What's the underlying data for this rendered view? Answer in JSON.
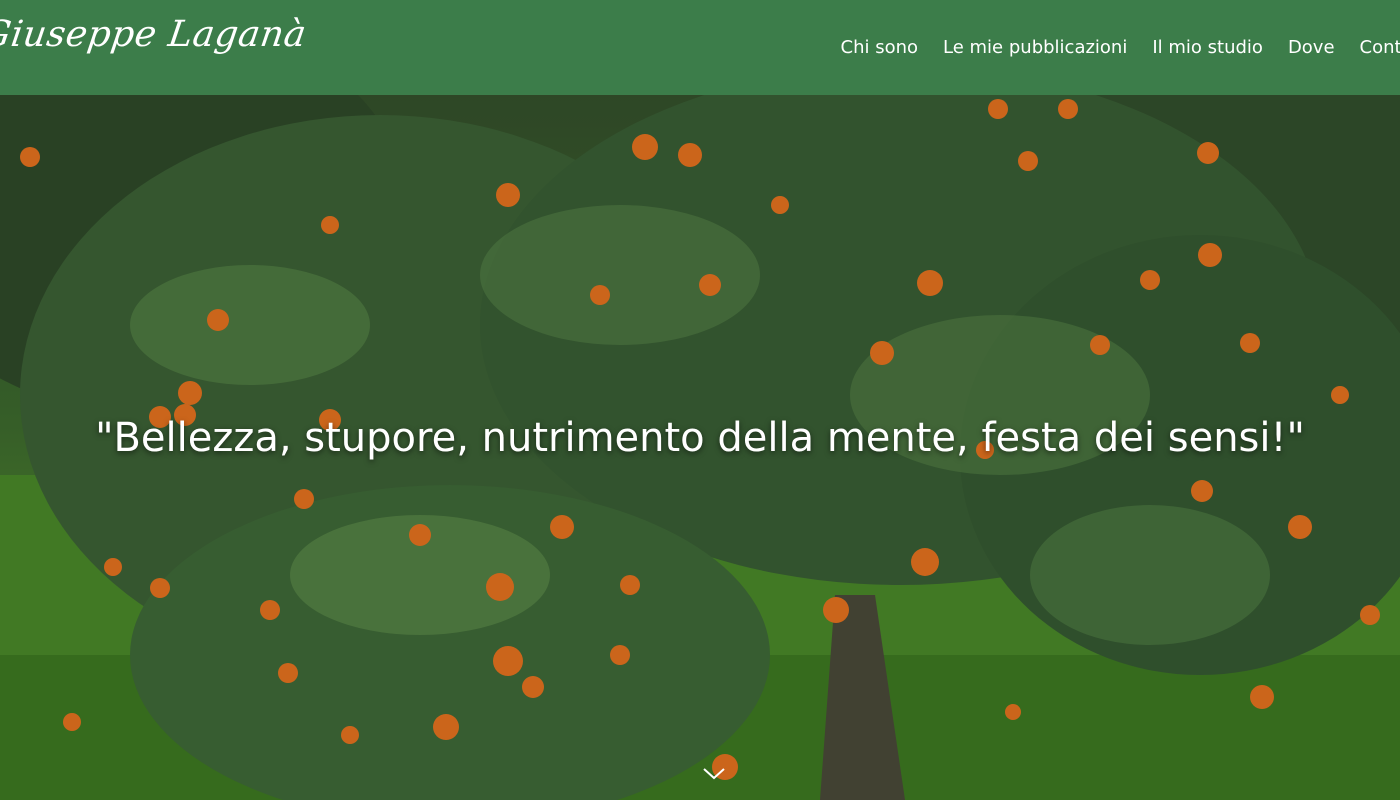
{
  "header": {
    "logo_text": "Giuseppe Laganà",
    "nav": [
      {
        "label": "Chi sono"
      },
      {
        "label": "Le mie pubblicazioni"
      },
      {
        "label": "Il mio studio"
      },
      {
        "label": "Dove"
      },
      {
        "label": "Contatti"
      }
    ]
  },
  "hero": {
    "quote": "\"Bellezza, stupore, nutrimento della mente, festa dei sensi!\"",
    "background_image": "orange-grove-photo",
    "scroll_icon": "chevron-down-icon"
  },
  "colors": {
    "header_bg": "#3c7d4a",
    "text": "#ffffff",
    "orange_fruit": "#e8741f"
  }
}
